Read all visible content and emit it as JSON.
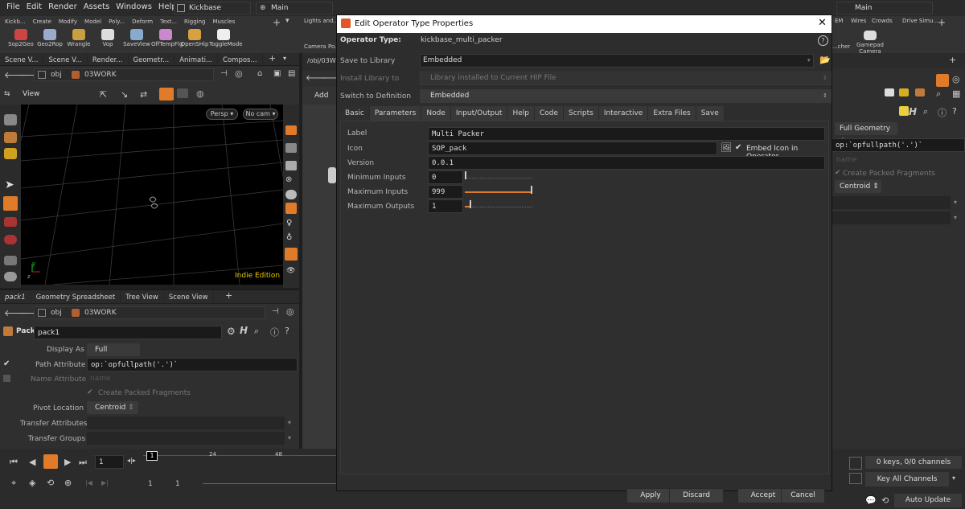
{
  "menu": [
    "File",
    "Edit",
    "Render",
    "Assets",
    "Windows",
    "Help"
  ],
  "desktop": "Kickbase",
  "desktop_right": "Main",
  "shelf_tabs": [
    "Kickb...",
    "Create",
    "Modify",
    "Model",
    "Poly...",
    "Deform",
    "Text...",
    "Rigging",
    "Muscles"
  ],
  "shelf_tools": [
    "Sop2Geo",
    "Geo2Rop",
    "Wrangle",
    "Vop",
    "SaveView",
    "OffTempFlg",
    "OpenSHip",
    "ToggleMode"
  ],
  "shelf_tabs_right": [
    "Lights and...",
    "EM",
    "Wires",
    "Crowds",
    "Drive Simu..."
  ],
  "shelf_tools_right": [
    "Camera",
    "Po...",
    "...cher",
    "Gamepad Camera"
  ],
  "pane_tabs_top": [
    "Scene V...",
    "Scene V...",
    "Render...",
    "Geometr...",
    "Animati...",
    "Compos..."
  ],
  "path": {
    "obj": "obj",
    "node": "03WORK"
  },
  "viewport": {
    "title": "View",
    "persp": "Persp",
    "cam": "No cam",
    "edition": "Indie Edition"
  },
  "network_path": "/obj/03WO",
  "add_label": "Add",
  "pane_tabs_bottom": [
    "pack1",
    "Geometry Spreadsheet",
    "Tree View",
    "Scene View"
  ],
  "params": {
    "node_type": "Pack",
    "node_name": "pack1",
    "display_as_label": "Display As",
    "display_as": "Full Geometry",
    "path_attr_label": "Path Attribute",
    "path_attr": "op:`opfullpath('.')`",
    "name_attr_label": "Name Attribute",
    "name_attr_placeholder": "name",
    "create_packed": "Create Packed Fragments",
    "pivot_label": "Pivot Location",
    "pivot": "Centroid",
    "transfer_attr_label": "Transfer Attributes",
    "transfer_groups_label": "Transfer Groups"
  },
  "timeline": {
    "frame": "1",
    "marker": "1",
    "tick1": "24",
    "tick2": "48",
    "start": "1",
    "end": "1"
  },
  "right_panel": {
    "display_as": "Full Geometry",
    "path_attr": "op:`opfullpath('.')`",
    "name_placeholder": "name",
    "create_packed": "Create Packed Fragments",
    "pivot": "Centroid",
    "keys": "0 keys, 0/0 channels",
    "key_all": "Key All Channels",
    "auto_update": "Auto Update"
  },
  "dialog": {
    "title": "Edit Operator Type Properties",
    "operator_type_label": "Operator Type:",
    "operator_type": "kickbase_multi_packer",
    "save_to_library_label": "Save to Library",
    "save_to_library": "Embedded",
    "install_library_label": "Install Library to",
    "install_library": "Library installed to Current HIP File",
    "switch_def_label": "Switch to Definition",
    "switch_def": "Embedded",
    "tabs": [
      "Basic",
      "Parameters",
      "Node",
      "Input/Output",
      "Help",
      "Code",
      "Scripts",
      "Interactive",
      "Extra Files",
      "Save"
    ],
    "label_label": "Label",
    "label": "Multi Packer",
    "icon_label": "Icon",
    "icon": "SOP_pack",
    "embed_icon": "Embed Icon in Operator",
    "version_label": "Version",
    "version": "0.0.1",
    "min_inputs_label": "Minimum Inputs",
    "min_inputs": "0",
    "max_inputs_label": "Maximum Inputs",
    "max_inputs": "999",
    "max_outputs_label": "Maximum Outputs",
    "max_outputs": "1",
    "buttons": {
      "apply": "Apply",
      "discard": "Discard",
      "accept": "Accept",
      "cancel": "Cancel"
    }
  },
  "colors": {
    "accent": "#e07b2a",
    "dialog_bg": "#2d2d2d",
    "title_bar": "#ffffff",
    "viewport": "#000000"
  }
}
